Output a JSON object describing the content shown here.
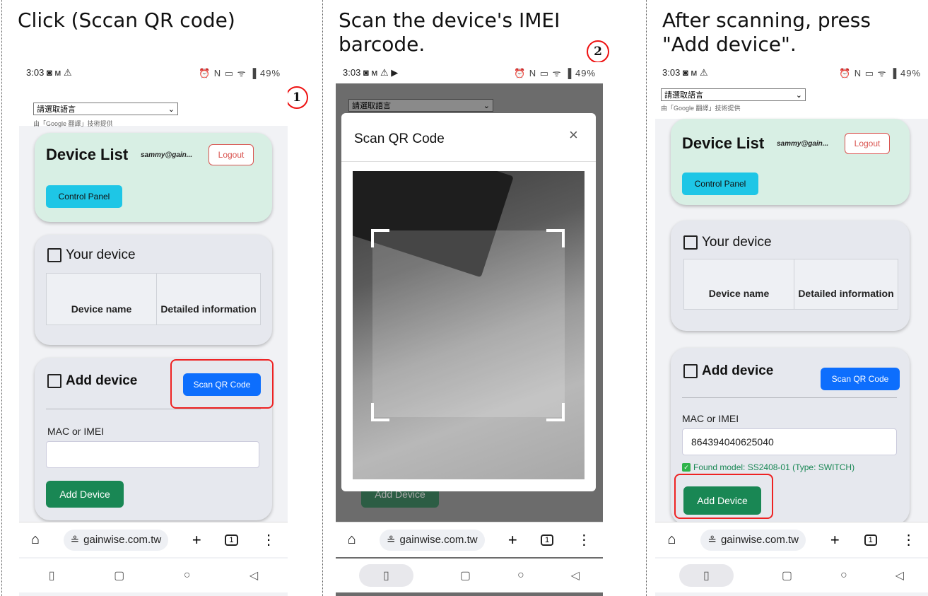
{
  "panels": [
    {
      "caption": "Click (Sccan QR code)",
      "badge": "1",
      "status_time": "3:03",
      "status_icons": "◙ ᴍ ⚠",
      "status_right": "⏰ N ▭ ᯤ ▐ 49%",
      "lang_select": "請選取語言",
      "powered_by": "由「Google 翻譯」技術提供",
      "device_list_title": "Device List",
      "email": "sammy@gain...",
      "logout": "Logout",
      "control_panel": "Control Panel",
      "your_device": "Your device",
      "col_device_name": "Device name",
      "col_detailed": "Detailed information",
      "add_device_title": "Add device",
      "scan_qr": "Scan QR Code",
      "mac_label": "MAC or IMEI",
      "mac_value": "",
      "add_device_btn": "Add Device",
      "url": "gainwise.com.tw",
      "tab_count": "1"
    },
    {
      "caption": "Scan the device's IMEI\nbarcode.",
      "badge": "2",
      "status_time": "3:03",
      "status_icons": "◙ ᴍ ⚠ ▶",
      "status_right": "⏰ N ▭ ᯤ ▐ 49%",
      "lang_select": "請選取語言",
      "modal_title": "Scan QR Code",
      "close": "×",
      "add_device_btn": "Add Device",
      "url": "gainwise.com.tw",
      "tab_count": "1"
    },
    {
      "caption": "After scanning, press\n\"Add device\".",
      "status_time": "3:03",
      "status_icons": "◙ ᴍ ⚠",
      "status_right": "⏰ N ▭ ᯤ ▐ 49%",
      "lang_select": "請選取語言",
      "powered_by": "由「Google 翻譯」技術提供",
      "device_list_title": "Device List",
      "email": "sammy@gain...",
      "logout": "Logout",
      "control_panel": "Control Panel",
      "your_device": "Your device",
      "col_device_name": "Device name",
      "col_detailed": "Detailed information",
      "add_device_title": "Add device",
      "scan_qr": "Scan QR Code",
      "mac_label": "MAC or IMEI",
      "mac_value": "864394040625040",
      "found_model": "Found model: SS2408-01 (Type: SWITCH)",
      "add_device_btn": "Add Device",
      "url": "gainwise.com.tw",
      "tab_count": "1"
    }
  ],
  "icons": {
    "home": "⌂",
    "site_settings": "≗",
    "new_tab": "+",
    "menu": "⋮",
    "nav_recent": "▯",
    "nav_home_square": "▢",
    "nav_circle": "○",
    "nav_back": "◁",
    "dropdown": "⌄",
    "check": "✓"
  },
  "colors": {
    "highlight": "#e22222",
    "primary": "#0d6efd",
    "success": "#198754",
    "info": "#1ec6e6",
    "danger": "#d9534f"
  }
}
